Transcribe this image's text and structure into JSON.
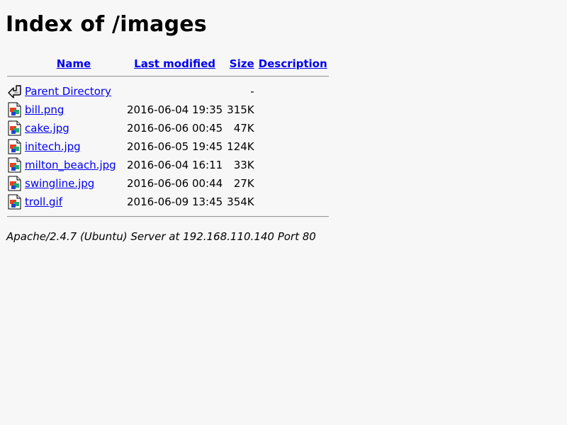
{
  "page": {
    "title": "Index of /images",
    "footer": "Apache/2.4.7 (Ubuntu) Server at 192.168.110.140 Port 80"
  },
  "table": {
    "headers": {
      "name": "Name",
      "last_modified": "Last modified",
      "size": "Size",
      "description": "Description"
    },
    "parent": {
      "label": "Parent Directory",
      "size": "-",
      "icon": "back-arrow-icon"
    },
    "rows": [
      {
        "name": "bill.png",
        "modified": "2016-06-04 19:35",
        "size": "315K",
        "icon": "image-file-icon"
      },
      {
        "name": "cake.jpg",
        "modified": "2016-06-06 00:45",
        "size": "47K",
        "icon": "image-file-icon"
      },
      {
        "name": "initech.jpg",
        "modified": "2016-06-05 19:45",
        "size": "124K",
        "icon": "image-file-icon"
      },
      {
        "name": "milton_beach.jpg",
        "modified": "2016-06-04 16:11",
        "size": "33K",
        "icon": "image-file-icon"
      },
      {
        "name": "swingline.jpg",
        "modified": "2016-06-06 00:44",
        "size": "27K",
        "icon": "image-file-icon"
      },
      {
        "name": "troll.gif",
        "modified": "2016-06-09 13:45",
        "size": "354K",
        "icon": "image-file-icon"
      }
    ]
  },
  "colors": {
    "link": "#0000ee",
    "background": "#f7f7f7"
  }
}
